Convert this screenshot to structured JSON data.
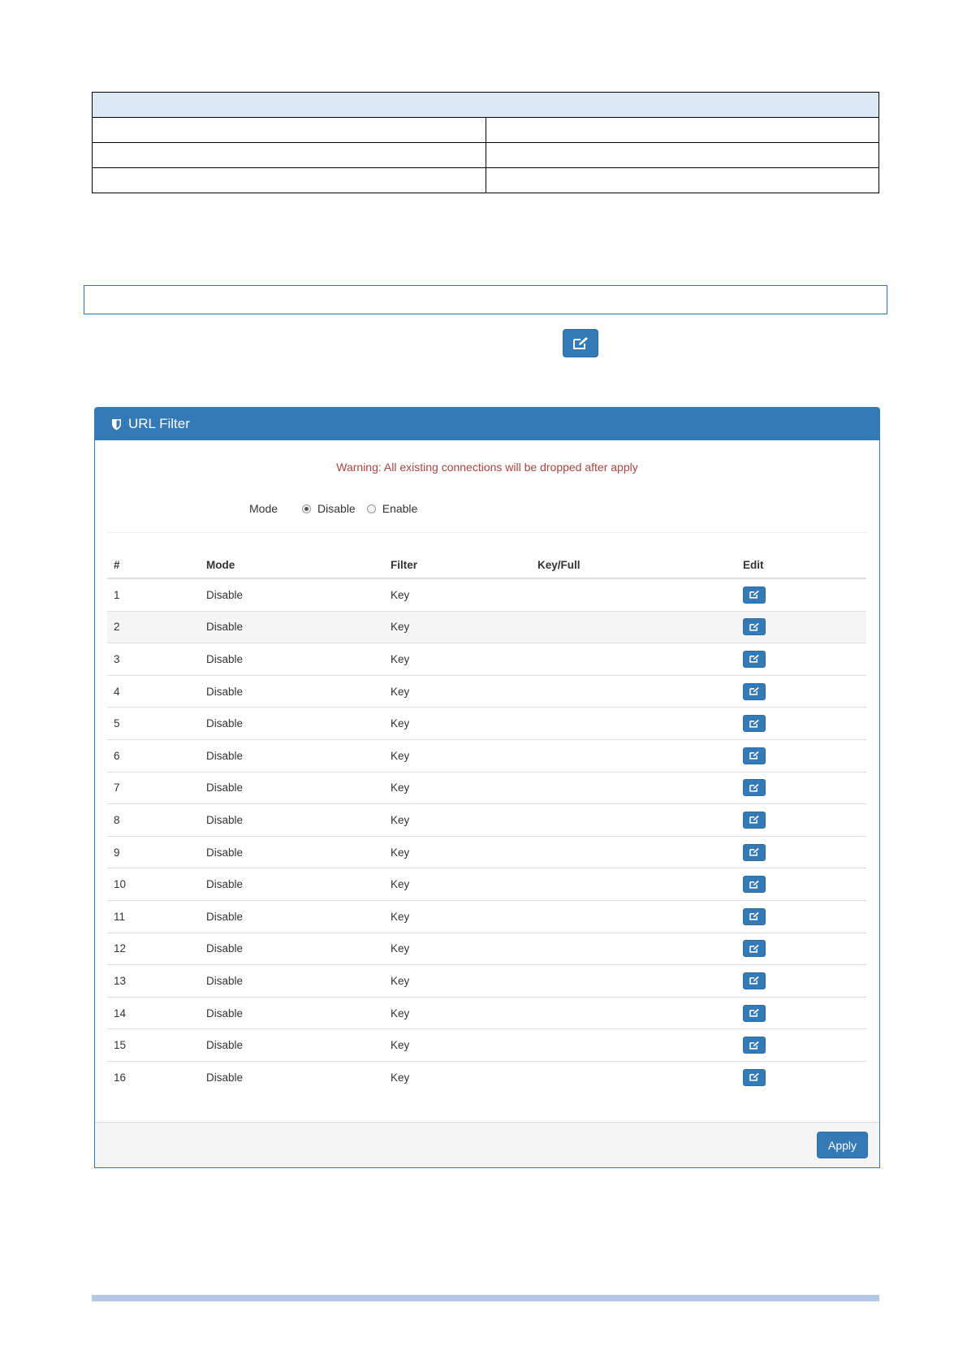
{
  "panel": {
    "title": "URL Filter",
    "warning": "Warning: All existing connections will be dropped after apply",
    "mode": {
      "label": "Mode",
      "options": [
        "Disable",
        "Enable"
      ],
      "selected": "Disable"
    },
    "table": {
      "headers": [
        "#",
        "Mode",
        "Filter",
        "Key/Full",
        "Edit"
      ],
      "rows": [
        {
          "num": "1",
          "mode": "Disable",
          "filter": "Key",
          "key": ""
        },
        {
          "num": "2",
          "mode": "Disable",
          "filter": "Key",
          "key": ""
        },
        {
          "num": "3",
          "mode": "Disable",
          "filter": "Key",
          "key": ""
        },
        {
          "num": "4",
          "mode": "Disable",
          "filter": "Key",
          "key": ""
        },
        {
          "num": "5",
          "mode": "Disable",
          "filter": "Key",
          "key": ""
        },
        {
          "num": "6",
          "mode": "Disable",
          "filter": "Key",
          "key": ""
        },
        {
          "num": "7",
          "mode": "Disable",
          "filter": "Key",
          "key": ""
        },
        {
          "num": "8",
          "mode": "Disable",
          "filter": "Key",
          "key": ""
        },
        {
          "num": "9",
          "mode": "Disable",
          "filter": "Key",
          "key": ""
        },
        {
          "num": "10",
          "mode": "Disable",
          "filter": "Key",
          "key": ""
        },
        {
          "num": "11",
          "mode": "Disable",
          "filter": "Key",
          "key": ""
        },
        {
          "num": "12",
          "mode": "Disable",
          "filter": "Key",
          "key": ""
        },
        {
          "num": "13",
          "mode": "Disable",
          "filter": "Key",
          "key": ""
        },
        {
          "num": "14",
          "mode": "Disable",
          "filter": "Key",
          "key": ""
        },
        {
          "num": "15",
          "mode": "Disable",
          "filter": "Key",
          "key": ""
        },
        {
          "num": "16",
          "mode": "Disable",
          "filter": "Key",
          "key": ""
        }
      ]
    },
    "apply_label": "Apply"
  },
  "icons": {
    "edit": "edit-icon",
    "shield": "shield-icon"
  },
  "colors": {
    "primary": "#337ab7",
    "warning": "#a94442",
    "table_header_bg": "#dce9f5",
    "footer_bar": "#b4c7e7"
  }
}
